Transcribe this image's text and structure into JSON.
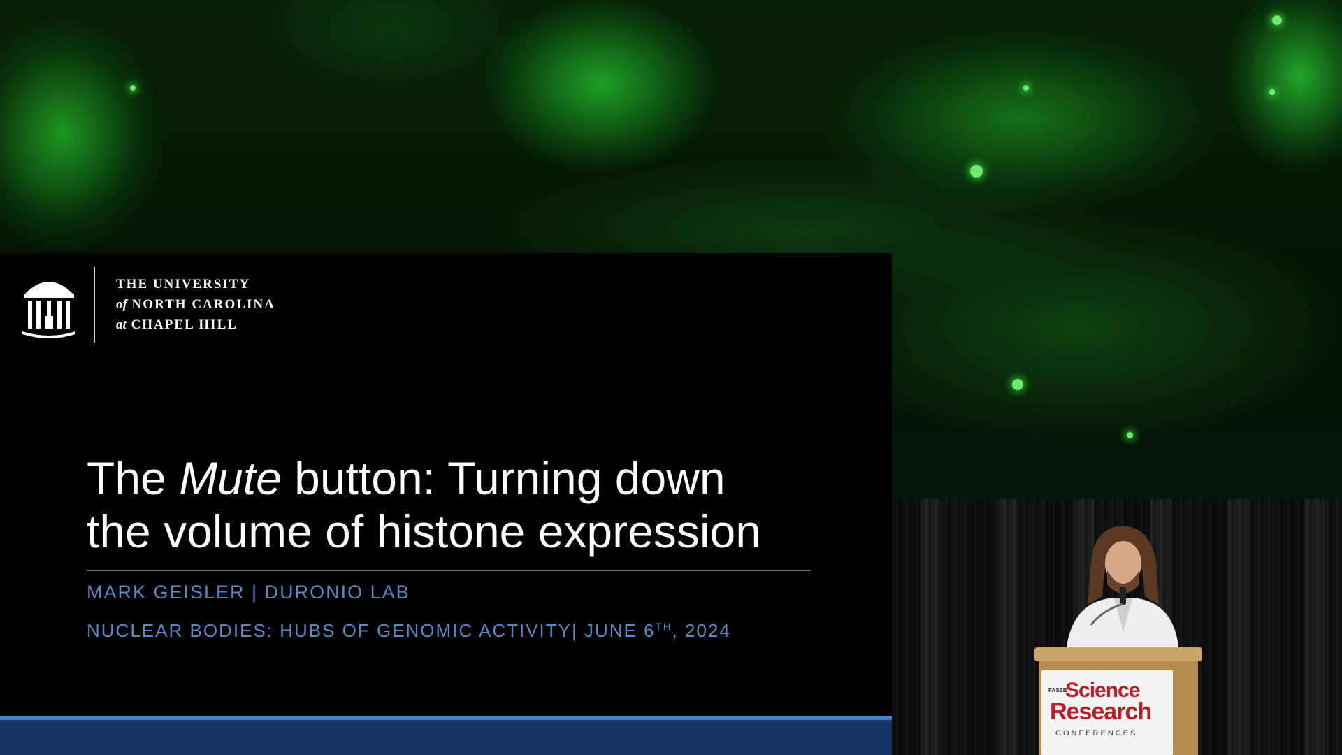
{
  "slide": {
    "university": {
      "line1": "THE UNIVERSITY",
      "line2_prefix": "of",
      "line2_main": "NORTH CAROLINA",
      "line3_prefix": "at",
      "line3_main": "CHAPEL HILL"
    },
    "title": {
      "part1": "The ",
      "part2_italic": "Mute",
      "part3": " button: Turning down",
      "line2": "the volume of histone expression"
    },
    "author_line": "MARK GEISLER | DURONIO LAB",
    "event_line": {
      "main": "NUCLEAR BODIES: HUBS OF GENOMIC ACTIVITY| JUNE 6",
      "sup": "TH",
      "tail": ", 2024"
    },
    "colors": {
      "accent_text": "#5f86bf",
      "footer_light": "#4a84c8",
      "footer_dark": "#173363"
    }
  },
  "camera": {
    "banner": {
      "faseb": "FASEB",
      "science": "Science",
      "research": "Research",
      "conferences": "CONFERENCES"
    },
    "banner_color": "#b71f2a"
  }
}
